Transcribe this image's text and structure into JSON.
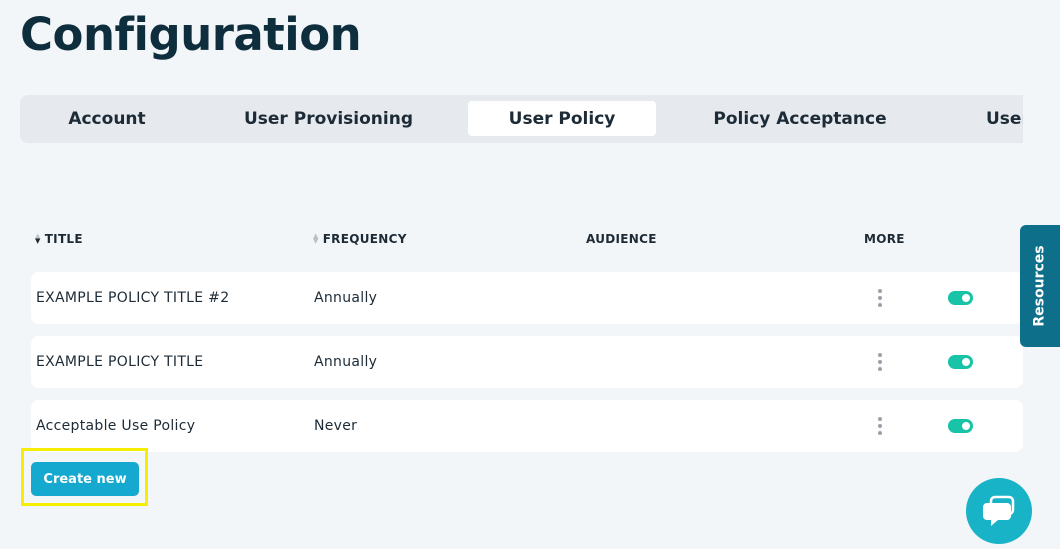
{
  "page": {
    "title": "Configuration"
  },
  "tabs": [
    {
      "label": "Account",
      "active": false
    },
    {
      "label": "User Provisioning",
      "active": false
    },
    {
      "label": "User Policy",
      "active": true
    },
    {
      "label": "Policy Acceptance",
      "active": false
    },
    {
      "label": "User",
      "active": false
    }
  ],
  "table": {
    "headers": {
      "title": "TITLE",
      "frequency": "FREQUENCY",
      "audience": "AUDIENCE",
      "more": "MORE"
    },
    "rows": [
      {
        "title": "EXAMPLE POLICY TITLE #2",
        "frequency": "Annually",
        "audience": "",
        "enabled": true
      },
      {
        "title": "EXAMPLE POLICY TITLE",
        "frequency": "Annually",
        "audience": "",
        "enabled": true
      },
      {
        "title": "Acceptable Use Policy",
        "frequency": "Never",
        "audience": "",
        "enabled": true
      }
    ]
  },
  "actions": {
    "create_label": "Create new"
  },
  "side_tab": {
    "label": "Resources"
  },
  "icons": {
    "sort": "sort-icon",
    "more": "kebab-menu-icon",
    "toggle": "toggle-switch",
    "chat": "chat-bubble-icon"
  },
  "colors": {
    "accent": "#15a9cf",
    "toggle_on": "#18c3a8",
    "resources_tab": "#0e6f8a",
    "highlight": "#f5ee00",
    "title": "#0f2e3d"
  }
}
